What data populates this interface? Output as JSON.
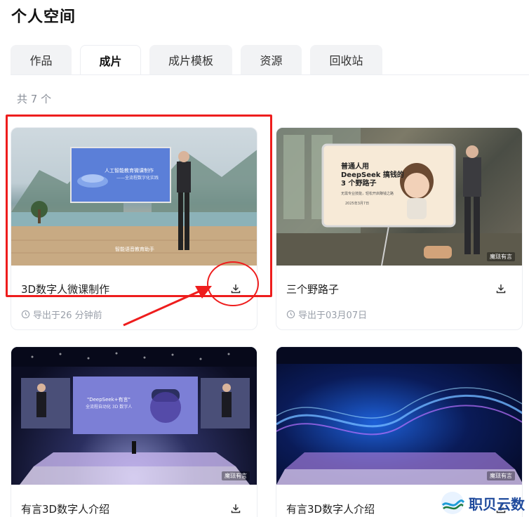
{
  "page": {
    "title": "个人空间"
  },
  "tabs": [
    {
      "label": "作品",
      "active": false
    },
    {
      "label": "成片",
      "active": true
    },
    {
      "label": "成片模板",
      "active": false
    },
    {
      "label": "资源",
      "active": false
    },
    {
      "label": "回收站",
      "active": false
    }
  ],
  "count_label": "共 7 个",
  "cards": [
    {
      "title": "3D数字人微课制作",
      "meta": "导出于26 分钟前",
      "thumb": {
        "slide_title": "人工智能教育微课制作",
        "slide_sub": "——全流程数字化实践",
        "caption": "智能语音教育助手"
      }
    },
    {
      "title": "三个野路子",
      "meta": "导出于03月07日",
      "thumb": {
        "slide_title": "普通人用\nDeepSeek 搞钱的\n3 个野路子",
        "slide_sub": "无需专业技能，轻松开启赚钱之路",
        "caption": "2025年3月7日",
        "tag": "魔琺有言"
      }
    },
    {
      "title": "有言3D数字人介绍",
      "meta": "",
      "thumb": {
        "slide_title": "\"DeepSeek+有言\"",
        "slide_sub": "全流程自动化 3D 数字人",
        "tag": "魔琺有言"
      }
    },
    {
      "title": "有言3D数字人介绍",
      "meta": "",
      "thumb": {
        "tag": "魔琺有言"
      }
    }
  ],
  "icons": {
    "download": "download-icon",
    "clock": "clock-icon"
  },
  "branding": {
    "logo_text": "职贝云数"
  },
  "colors": {
    "annotation": "#ee1d1d",
    "tab_bg": "#f2f3f5",
    "muted_text": "#9aa0aa",
    "logo_blue": "#1f4a9c"
  }
}
